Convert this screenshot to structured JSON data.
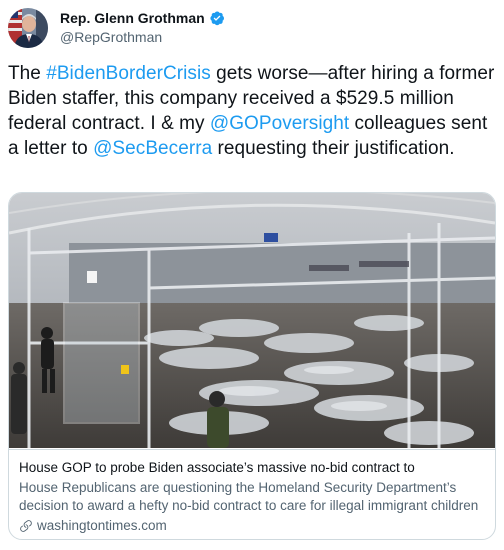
{
  "author": {
    "display_name": "Rep. Glenn Grothman",
    "handle": "@RepGrothman",
    "verified": true
  },
  "tweet": {
    "parts": [
      {
        "text": "The ",
        "link": false
      },
      {
        "text": "#BidenBorderCrisis",
        "link": true
      },
      {
        "text": " gets worse—after hiring a former Biden staffer, this company received a $529.5 million federal contract. I & my ",
        "link": false
      },
      {
        "text": "@GOPoversight",
        "link": true
      },
      {
        "text": " colleagues sent a letter to ",
        "link": false
      },
      {
        "text": "@SecBecerra",
        "link": true
      },
      {
        "text": " requesting their justification.",
        "link": false
      }
    ]
  },
  "card": {
    "title": "House GOP to probe Biden associate’s massive no-bid contract to",
    "description": "House Republicans are questioning the Homeland Security Department’s decision to award a hefty no-bid contract to care for illegal immigrant children to Family ...",
    "domain": "washingtontimes.com"
  },
  "colors": {
    "link": "#1d9bf0",
    "verified_badge": "#1d9bf0",
    "secondary_text": "#536471",
    "border": "#cfd9de"
  },
  "icons": [
    "verified-badge-icon",
    "link-icon"
  ]
}
